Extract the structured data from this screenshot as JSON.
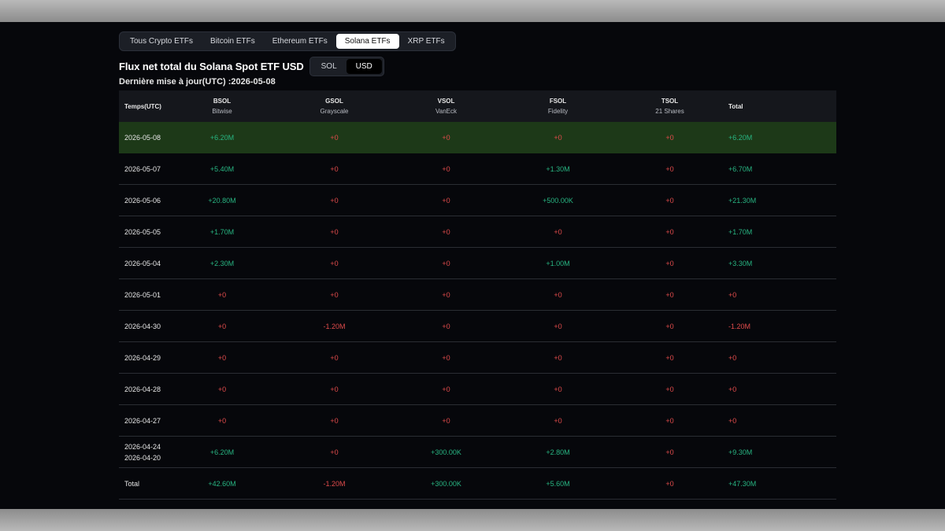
{
  "tabs": [
    {
      "label": "Tous Crypto ETFs",
      "active": false
    },
    {
      "label": "Bitcoin ETFs",
      "active": false
    },
    {
      "label": "Ethereum ETFs",
      "active": false
    },
    {
      "label": "Solana ETFs",
      "active": true
    },
    {
      "label": "XRP ETFs",
      "active": false
    }
  ],
  "title": "Flux net total du Solana Spot ETF USD",
  "unit_toggle": [
    {
      "label": "SOL",
      "active": false
    },
    {
      "label": "USD",
      "active": true
    }
  ],
  "updated": "Dernière mise à jour(UTC) :2026-05-08",
  "table": {
    "date_header": "Temps(UTC)",
    "total_header": "Total",
    "columns": [
      {
        "code": "BSOL",
        "issuer": "Bitwise"
      },
      {
        "code": "GSOL",
        "issuer": "Grayscale"
      },
      {
        "code": "VSOL",
        "issuer": "VanEck"
      },
      {
        "code": "FSOL",
        "issuer": "Fidelity"
      },
      {
        "code": "TSOL",
        "issuer": "21 Shares"
      }
    ],
    "rows": [
      {
        "date": [
          "2026-05-08"
        ],
        "values": [
          "+6.20M",
          "+0",
          "+0",
          "+0",
          "+0"
        ],
        "total": "+6.20M",
        "highlight": true
      },
      {
        "date": [
          "2026-05-07"
        ],
        "values": [
          "+5.40M",
          "+0",
          "+0",
          "+1.30M",
          "+0"
        ],
        "total": "+6.70M"
      },
      {
        "date": [
          "2026-05-06"
        ],
        "values": [
          "+20.80M",
          "+0",
          "+0",
          "+500.00K",
          "+0"
        ],
        "total": "+21.30M"
      },
      {
        "date": [
          "2026-05-05"
        ],
        "values": [
          "+1.70M",
          "+0",
          "+0",
          "+0",
          "+0"
        ],
        "total": "+1.70M"
      },
      {
        "date": [
          "2026-05-04"
        ],
        "values": [
          "+2.30M",
          "+0",
          "+0",
          "+1.00M",
          "+0"
        ],
        "total": "+3.30M"
      },
      {
        "date": [
          "2026-05-01"
        ],
        "values": [
          "+0",
          "+0",
          "+0",
          "+0",
          "+0"
        ],
        "total": "+0"
      },
      {
        "date": [
          "2026-04-30"
        ],
        "values": [
          "+0",
          "-1.20M",
          "+0",
          "+0",
          "+0"
        ],
        "total": "-1.20M"
      },
      {
        "date": [
          "2026-04-29"
        ],
        "values": [
          "+0",
          "+0",
          "+0",
          "+0",
          "+0"
        ],
        "total": "+0"
      },
      {
        "date": [
          "2026-04-28"
        ],
        "values": [
          "+0",
          "+0",
          "+0",
          "+0",
          "+0"
        ],
        "total": "+0"
      },
      {
        "date": [
          "2026-04-27"
        ],
        "values": [
          "+0",
          "+0",
          "+0",
          "+0",
          "+0"
        ],
        "total": "+0"
      },
      {
        "date": [
          "2026-04-24",
          "2026-04-20"
        ],
        "values": [
          "+6.20M",
          "+0",
          "+300.00K",
          "+2.80M",
          "+0"
        ],
        "total": "+9.30M"
      },
      {
        "date": [
          "Total"
        ],
        "values": [
          "+42.60M",
          "-1.20M",
          "+300.00K",
          "+5.60M",
          "+0"
        ],
        "total": "+47.30M"
      }
    ]
  },
  "colors": {
    "positive": "#28b582",
    "zero_negative": "#e04b4b",
    "highlight_row": "#1d3918"
  }
}
